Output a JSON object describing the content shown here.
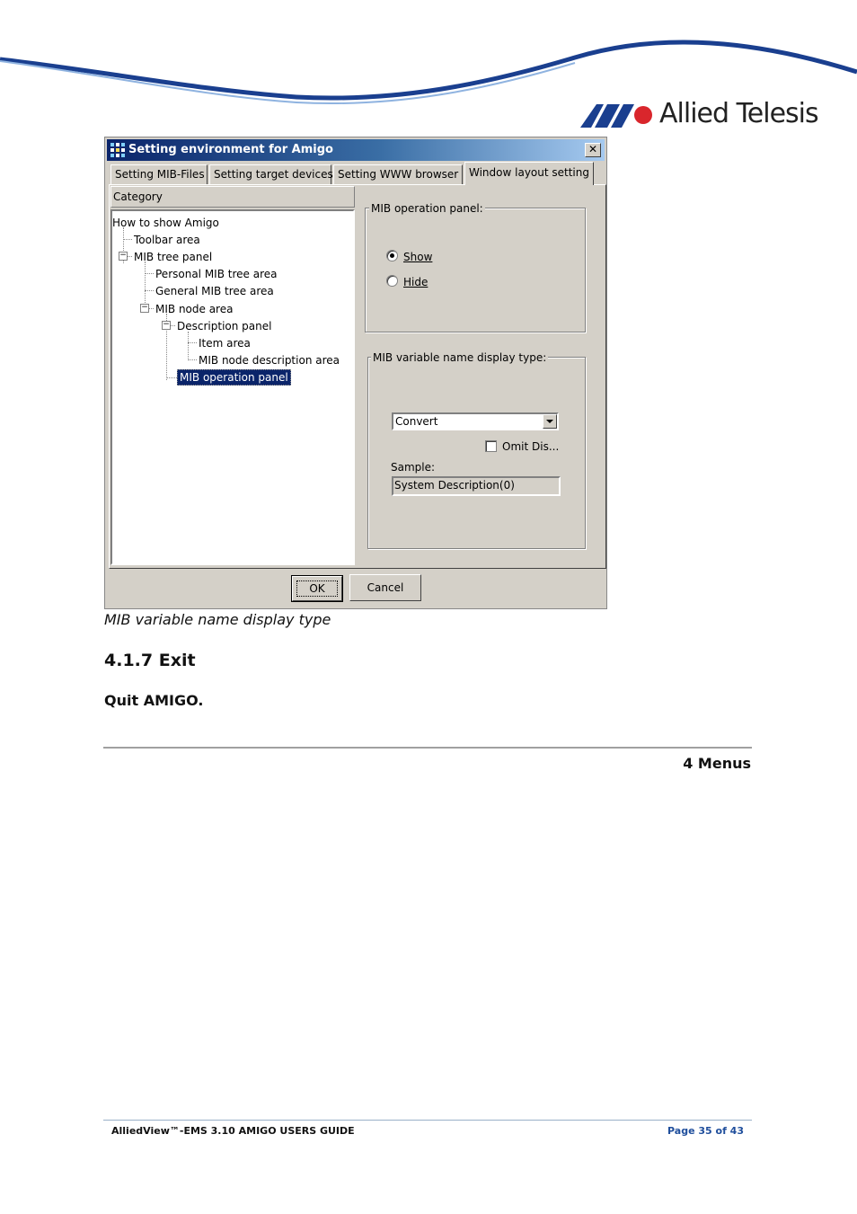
{
  "header": {
    "brand": "Allied Telesis",
    "brand_color": "#1a3f8f"
  },
  "dialog": {
    "title": "Setting environment for Amigo",
    "close_glyph": "✕",
    "tabs": [
      {
        "label": "Setting MIB-Files"
      },
      {
        "label": "Setting target devices"
      },
      {
        "label": "Setting WWW browser"
      },
      {
        "label": "Window layout setting",
        "active": true
      }
    ],
    "category_header": "Category",
    "tree": [
      {
        "label": "How to show Amigo"
      },
      {
        "label": "Toolbar area"
      },
      {
        "label": "MIB tree panel"
      },
      {
        "label": "Personal MIB tree area"
      },
      {
        "label": "General MIB tree area"
      },
      {
        "label": "MIB node area"
      },
      {
        "label": "Description panel"
      },
      {
        "label": "Item area"
      },
      {
        "label": "MIB node description area"
      },
      {
        "label": "MIB operation panel",
        "selected": true
      }
    ],
    "operation_panel": {
      "group_label": "MIB operation panel:",
      "options": [
        "Show",
        "Hide"
      ],
      "selected": "Show"
    },
    "name_display": {
      "group_label": "MIB variable name display type:",
      "select_value": "Convert",
      "checkbox_label": "Omit Dis...",
      "checkbox_checked": false,
      "sample_label": "Sample:",
      "sample_value": "System Description(0)"
    },
    "buttons": {
      "ok": "OK",
      "cancel": "Cancel"
    }
  },
  "document": {
    "caption": "MIB variable name display type",
    "section_heading": "4.1.7 Exit",
    "body": "Quit AMIGO.",
    "chapter": "4 Menus"
  },
  "footer": {
    "left": "AlliedView™-EMS 3.10 AMIGO USERS GUIDE",
    "right": "Page 35 of 43"
  }
}
